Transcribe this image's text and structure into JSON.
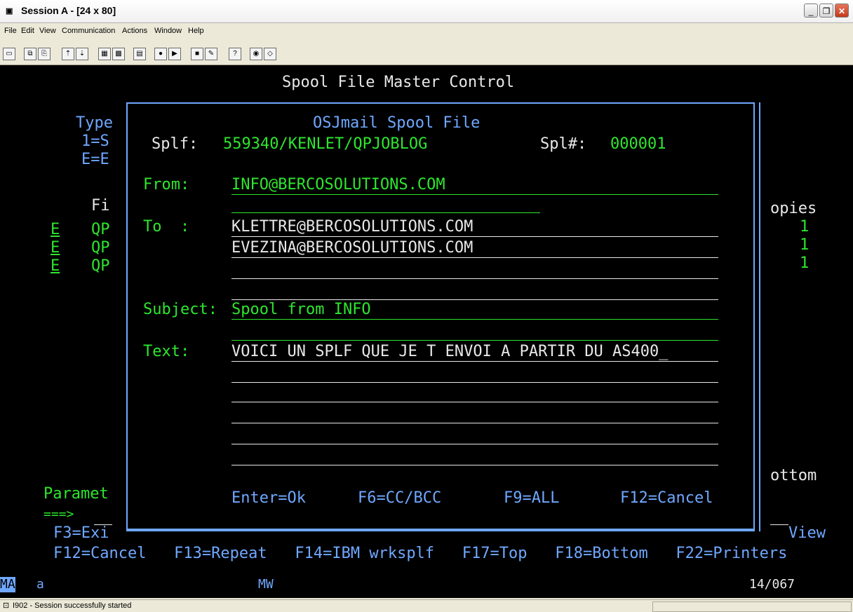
{
  "window": {
    "title": "Session A - [24 x 80]",
    "icon": "session-icon",
    "controls": [
      "_",
      "❐",
      "✕"
    ]
  },
  "menu": [
    "File",
    "Edit",
    "View",
    "Communication",
    "Actions",
    "Window",
    "Help"
  ],
  "toolbar_icons": [
    "print-screen-icon",
    "copy-icon",
    "paste-icon",
    "send-file-icon",
    "receive-file-icon",
    "display-icon",
    "keypad-icon",
    "macro-icon",
    "record-macro-icon",
    "play-macro-icon",
    "stop-macro-icon",
    "customize-icon",
    "help-icon",
    "connect-icon"
  ],
  "screen": {
    "title": "Spool File Master Control",
    "background": {
      "type_label": "Type",
      "opt1": "1=S",
      "opt2": "E=E",
      "col_file": "Fi",
      "rows": [
        {
          "opt": "E",
          "file": "QP",
          "copies": "1"
        },
        {
          "opt": "E",
          "file": "QP",
          "copies": "1"
        },
        {
          "opt": "E",
          "file": "QP",
          "copies": "1"
        }
      ],
      "col_copies": "opies",
      "bottom_label": "ottom",
      "param_label": "Paramet",
      "prompt": "===>",
      "f3": "F3=Exi",
      "view": "View",
      "fkeys": "F12=Cancel   F13=Repeat   F14=IBM wrksplf   F17=Top   F18=Bottom   F22=Printers"
    },
    "popup": {
      "title": "OSJmail Spool File",
      "splf_label": "Splf:",
      "splf_value": "559340/KENLET/QPJOBLOG",
      "splnum_label": "Spl#:",
      "splnum_value": "000001",
      "from_label": "From:",
      "from_value": "INFO@BERCOSOLUTIONS.COM",
      "to_label": "To  :",
      "to_values": [
        "KLETTRE@BERCOSOLUTIONS.COM",
        "EVEZINA@BERCOSOLUTIONS.COM",
        ""
      ],
      "subject_label": "Subject:",
      "subject_value": "Spool from INFO",
      "text_label": "Text:",
      "text_values": [
        "VOICI UN SPLF QUE JE T ENVOI A PARTIR DU AS400_",
        "",
        "",
        "",
        "",
        ""
      ],
      "key_enter": "Enter=Ok",
      "key_f6": "F6=CC/BCC",
      "key_f9": "F9=ALL",
      "key_f12": "F12=Cancel"
    }
  },
  "oia": {
    "ma": "MA",
    "indicator": "a",
    "mw": "MW",
    "cursor": "14/067"
  },
  "status": {
    "message": "I902 - Session successfully started"
  },
  "colors": {
    "green": "#2ee62e",
    "white": "#e8e8e8",
    "blue": "#6fa8ff",
    "background": "#000000"
  }
}
